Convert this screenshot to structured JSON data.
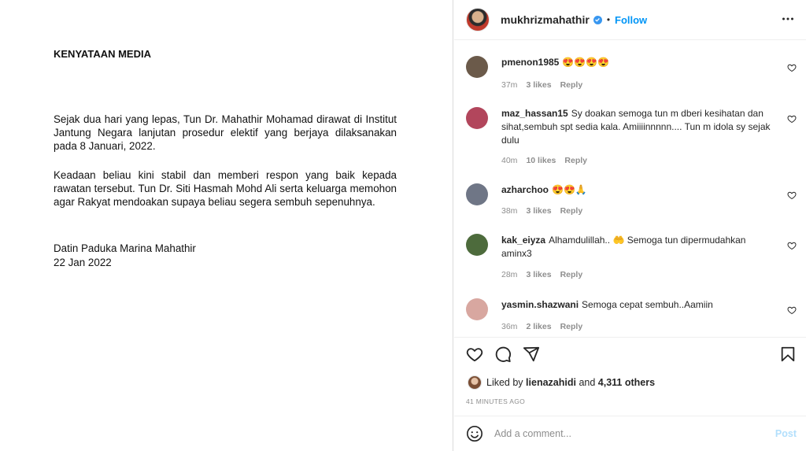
{
  "post_image": {
    "title": "KENYATAAN MEDIA",
    "paragraph1": "Sejak dua hari yang lepas, Tun Dr. Mahathir Mohamad dirawat di Institut Jantung Negara lanjutan prosedur elektif yang berjaya dilaksanakan pada 8 Januari, 2022.",
    "paragraph2": "Keadaan beliau kini stabil dan memberi respon yang baik kepada rawatan tersebut. Tun Dr. Siti Hasmah Mohd Ali serta keluarga memohon agar Rakyat mendoakan supaya beliau segera sembuh sepenuhnya.",
    "signature_name": "Datin Paduka Marina Mahathir",
    "signature_date": "22 Jan 2022"
  },
  "header": {
    "username": "mukhrizmahathir",
    "separator": "•",
    "follow_label": "Follow",
    "verified_icon": "verified-badge-icon",
    "more_icon": "more-options-icon"
  },
  "comments": [
    {
      "username": "pmenon1985",
      "text": "😍😍😍😍",
      "time": "37m",
      "likes": "3 likes",
      "reply": "Reply",
      "avatar_color": "#6b5a4a"
    },
    {
      "username": "maz_hassan15",
      "text": "Sy doakan semoga tun m dberi kesihatan dan sihat,sembuh spt sedia kala. Amiiiinnnnn.... Tun m idola sy sejak dulu",
      "time": "40m",
      "likes": "10 likes",
      "reply": "Reply",
      "avatar_color": "#b2465c"
    },
    {
      "username": "azharchoo",
      "text": "😍😍🙏",
      "time": "38m",
      "likes": "3 likes",
      "reply": "Reply",
      "avatar_color": "#6f7686"
    },
    {
      "username": "kak_eiyza",
      "text": "Alhamdulillah.. 🤲 Semoga tun dipermudahkan aminx3",
      "time": "28m",
      "likes": "3 likes",
      "reply": "Reply",
      "avatar_color": "#4d6b3c"
    },
    {
      "username": "yasmin.shazwani",
      "text": "Semoga cepat sembuh..Aamiin",
      "time": "36m",
      "likes": "2 likes",
      "reply": "Reply",
      "avatar_color": "#d8a7a0"
    }
  ],
  "actions": {
    "like_icon": "heart-icon",
    "comment_icon": "comment-icon",
    "share_icon": "share-icon",
    "save_icon": "bookmark-icon"
  },
  "likes_summary": {
    "prefix": "Liked by",
    "user": "lienazahidi",
    "connector": "and",
    "others": "4,311 others"
  },
  "timestamp": "41 MINUTES AGO",
  "add_comment": {
    "placeholder": "Add a comment...",
    "post_label": "Post",
    "emoji_icon": "emoji-smile-icon"
  },
  "colors": {
    "accent": "#0095f6",
    "muted": "#8e8e8e",
    "border": "#dbdbdb"
  }
}
